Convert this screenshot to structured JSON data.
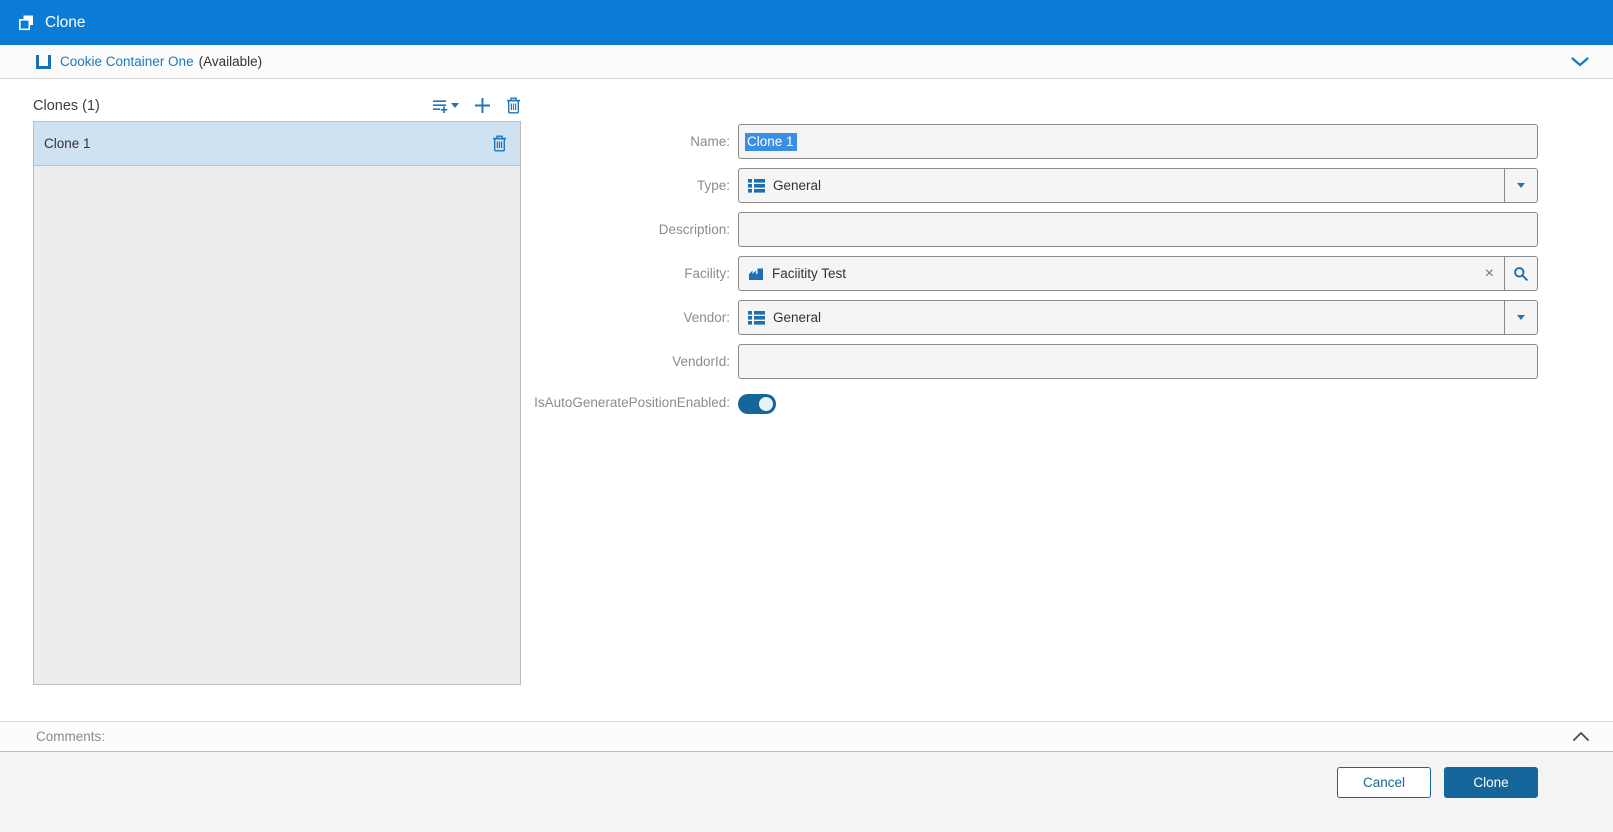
{
  "window": {
    "title": "Clone"
  },
  "subheader": {
    "entity": "Cookie Container One",
    "status": "(Available)"
  },
  "clones_panel": {
    "title": "Clones (1)",
    "items": [
      {
        "name": "Clone 1",
        "selected": true
      }
    ]
  },
  "form": {
    "name": {
      "label": "Name:",
      "value": "Clone 1",
      "value_selected": true
    },
    "type": {
      "label": "Type:",
      "value": "General"
    },
    "description": {
      "label": "Description:",
      "value": ""
    },
    "facility": {
      "label": "Facility:",
      "value": "Faciitity Test"
    },
    "vendor": {
      "label": "Vendor:",
      "value": "General"
    },
    "vendor_id": {
      "label": "VendorId:",
      "value": ""
    },
    "auto_generate": {
      "label": "IsAutoGeneratePositionEnabled:",
      "enabled": true
    }
  },
  "comments": {
    "label": "Comments:"
  },
  "footer": {
    "cancel_label": "Cancel",
    "clone_label": "Clone"
  },
  "colors": {
    "header_blue": "#0b7bd5",
    "accent_blue": "#15679b",
    "icon_blue": "#2176b5",
    "link_blue": "#1779c4",
    "selection_blue": "#3a8ee4",
    "selected_item_bg": "#cfe2f2"
  }
}
